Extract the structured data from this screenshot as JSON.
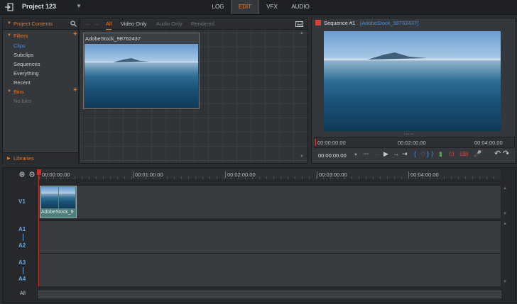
{
  "app": {
    "project_name": "Project 123",
    "tabs": [
      {
        "label": "LOG"
      },
      {
        "label": "EDIT"
      },
      {
        "label": "VFX"
      },
      {
        "label": "AUDIO"
      }
    ],
    "active_tab": "EDIT",
    "accent_color": "#f07a1a"
  },
  "project": {
    "header": "Project Contents",
    "filters_label": "Filters",
    "filter_items": [
      "Clips",
      "Subclips",
      "Sequences",
      "Everything",
      "Recent"
    ],
    "bins_label": "Bins",
    "bins_empty": "No bins",
    "libraries_label": "Libraries"
  },
  "browser": {
    "filter_tabs": [
      "All",
      "Video Only",
      "Audio Only",
      "Rendered"
    ],
    "clip_name": "AdobeStock_98762437"
  },
  "viewer": {
    "sequence_label": "Sequence #1",
    "source_label": "[AdobeStock_98762437]",
    "ruler_start": "00:00:00.00",
    "ruler_mid": "00:02:00.00",
    "ruler_end": "00:04:00.00",
    "timecode": "00:00:00.00"
  },
  "timeline": {
    "ruler_labels": [
      "00:00:00.00",
      "00:01:00.00",
      "00:02:00.00",
      "00:03:00.00",
      "00:04:00.00"
    ],
    "tracks": {
      "v1": "V1",
      "a1": "A1",
      "a2": "A2",
      "a3": "A3",
      "a4": "A4"
    },
    "all_label": "All",
    "clip_label": "AdobeStock_9"
  }
}
